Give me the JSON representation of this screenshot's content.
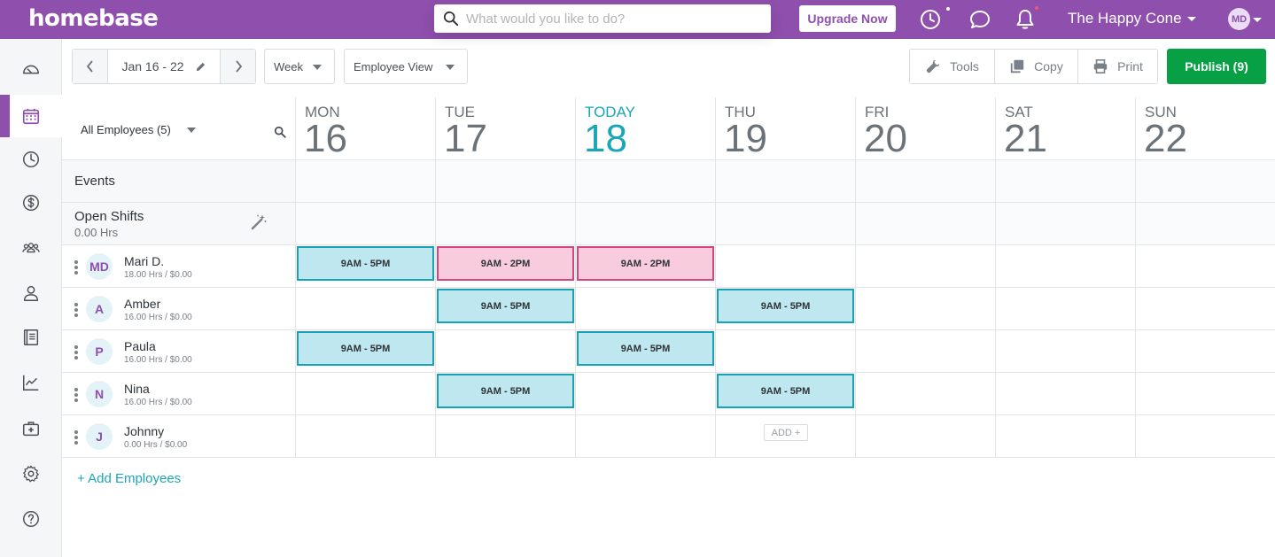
{
  "topbar": {
    "logo": "homebase",
    "search_placeholder": "What would you like to do?",
    "upgrade_label": "Upgrade Now",
    "company": "The Happy Cone",
    "user_initials": "MD",
    "icons": [
      "clock-icon",
      "chat-icon",
      "bell-icon"
    ],
    "colors": {
      "brand": "#8e4fad",
      "notification_dot": "#e65b7c"
    }
  },
  "sidebar": {
    "items": [
      {
        "name": "dashboard",
        "icon": "speedometer-icon"
      },
      {
        "name": "schedule",
        "icon": "calendar-icon",
        "active": true
      },
      {
        "name": "timesheets",
        "icon": "clock-icon"
      },
      {
        "name": "payroll",
        "icon": "dollar-icon"
      },
      {
        "name": "team",
        "icon": "team-icon"
      },
      {
        "name": "hiring",
        "icon": "person-icon"
      },
      {
        "name": "logbook",
        "icon": "book-icon"
      },
      {
        "name": "reports",
        "icon": "chart-icon"
      },
      {
        "name": "health",
        "icon": "medkit-icon"
      },
      {
        "name": "settings",
        "icon": "gear-icon"
      },
      {
        "name": "help",
        "icon": "help-icon"
      }
    ]
  },
  "toolbar": {
    "date_range": "Jan 16 - 22",
    "view_period": "Week",
    "view_mode": "Employee View",
    "tools_label": "Tools",
    "copy_label": "Copy",
    "print_label": "Print",
    "publish_label": "Publish (9)",
    "colors": {
      "publish": "#08a045"
    }
  },
  "schedule": {
    "filter_label": "All Employees (5)",
    "days": [
      {
        "name": "MON",
        "num": "16"
      },
      {
        "name": "TUE",
        "num": "17"
      },
      {
        "name": "TODAY",
        "num": "18",
        "today": true
      },
      {
        "name": "THU",
        "num": "19"
      },
      {
        "name": "FRI",
        "num": "20"
      },
      {
        "name": "SAT",
        "num": "21"
      },
      {
        "name": "SUN",
        "num": "22"
      }
    ],
    "events_label": "Events",
    "open_shifts_label": "Open Shifts",
    "open_shifts_hours": "0.00 Hrs",
    "employees": [
      {
        "initials": "MD",
        "name": "Mari D.",
        "hours": "18.00 Hrs / $0.00",
        "shifts": [
          "9AM - 5PM",
          "9AM - 2PM",
          "9AM - 2PM",
          "",
          "",
          "",
          ""
        ],
        "styles": [
          "blue",
          "pink",
          "pink",
          "",
          "",
          "",
          ""
        ]
      },
      {
        "initials": "A",
        "name": "Amber",
        "hours": "16.00 Hrs / $0.00",
        "shifts": [
          "",
          "9AM - 5PM",
          "",
          "9AM - 5PM",
          "",
          "",
          ""
        ],
        "styles": [
          "",
          "blue",
          "",
          "blue",
          "",
          "",
          ""
        ]
      },
      {
        "initials": "P",
        "name": "Paula",
        "hours": "16.00 Hrs / $0.00",
        "shifts": [
          "9AM - 5PM",
          "",
          "9AM - 5PM",
          "",
          "",
          "",
          ""
        ],
        "styles": [
          "blue",
          "",
          "blue",
          "",
          "",
          "",
          ""
        ]
      },
      {
        "initials": "N",
        "name": "Nina",
        "hours": "16.00 Hrs / $0.00",
        "shifts": [
          "",
          "9AM - 5PM",
          "",
          "9AM - 5PM",
          "",
          "",
          ""
        ],
        "styles": [
          "",
          "blue",
          "",
          "blue",
          "",
          "",
          ""
        ]
      },
      {
        "initials": "J",
        "name": "Johnny",
        "hours": "0.00 Hrs / $0.00",
        "shifts": [
          "",
          "",
          "",
          "",
          "",
          "",
          ""
        ],
        "styles": [
          "",
          "",
          "",
          "",
          "",
          "",
          ""
        ],
        "add_day": 3
      }
    ],
    "add_label": "ADD +",
    "add_employees_label": "+ Add Employees",
    "colors": {
      "shift_blue_border": "#17a1b4",
      "shift_blue_fill": "#bfe7ef",
      "shift_pink_border": "#d4457f",
      "shift_pink_fill": "#f8ccdd",
      "today": "#1ba6b8"
    }
  }
}
